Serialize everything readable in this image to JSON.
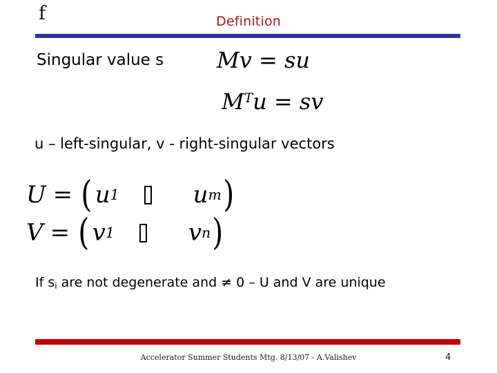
{
  "slide": {
    "corner_mark": "f",
    "title": "Definition",
    "title_color": "#9E1B1B",
    "title_rule_color": "#333399",
    "footer_rule_color": "#C00000",
    "background": "#FFFFFF"
  },
  "body": {
    "line_singular": "Singular value s",
    "line_vectors": "u – left-singular, v - right-singular vectors",
    "line_unique_prefix": "If s",
    "line_unique_sub": "i",
    "line_unique_rest": " are not degenerate and ≠ 0 – U and V are unique"
  },
  "equations": {
    "eq1": {
      "lhs_matrix": "M",
      "lhs_vector": "v",
      "operator": "=",
      "rhs_scalar": "s",
      "rhs_vector": "u",
      "plain": "Mv = su"
    },
    "eq2": {
      "lhs_matrix": "M",
      "lhs_superscript": "T",
      "lhs_vector": "u",
      "operator": "=",
      "rhs_scalar": "s",
      "rhs_vector": "v",
      "plain": "M^T u = sv"
    },
    "eq3": {
      "name": "U",
      "operator": "=",
      "open_paren": "(",
      "first_symbol": "u",
      "first_subscript": "1",
      "middle_glyph": "missing-glyph-box",
      "last_symbol": "u",
      "last_subscript": "m",
      "close_paren": ")",
      "plain": "U = (u1 … um)"
    },
    "eq4": {
      "name": "V",
      "operator": "=",
      "open_paren": "(",
      "first_symbol": "v",
      "first_subscript": "1",
      "middle_glyph": "missing-glyph-box",
      "last_symbol": "v",
      "last_subscript": "n",
      "close_paren": ")",
      "plain": "V = (v1 … vn)"
    }
  },
  "footer": {
    "text": "Accelerator Summer Students Mtg. 8/13/07 -  A.Valishev",
    "page_number": "4"
  }
}
